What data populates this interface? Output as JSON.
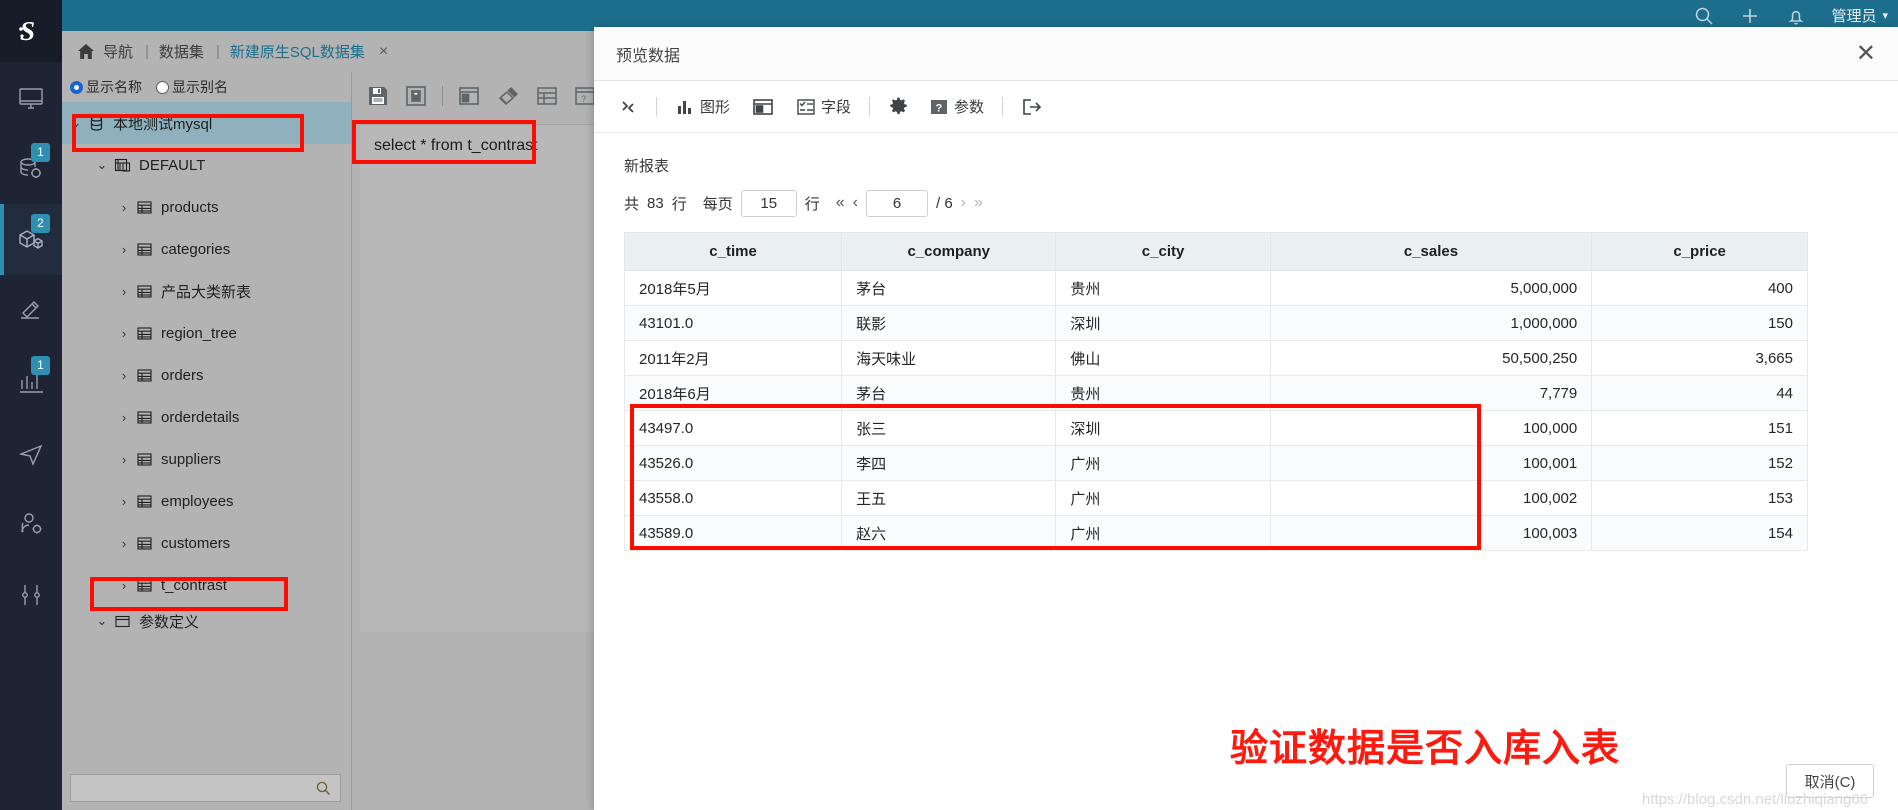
{
  "topbar": {
    "icons": [
      "search-icon",
      "plus-icon",
      "bell-icon"
    ],
    "user": "管理员",
    "brand_color": "#1d6e8c"
  },
  "tabs": {
    "home_label": "导航",
    "crumb": "数据集",
    "active_tab": "新建原生SQL数据集",
    "close": "×"
  },
  "left_panel": {
    "radio_name": "显示名称",
    "radio_alias": "显示别名",
    "tree": [
      {
        "label": "本地测试mysql",
        "depth": 0,
        "icon": "database-icon",
        "chev": "⌄",
        "selected": true
      },
      {
        "label": "DEFAULT",
        "depth": 1,
        "icon": "schema-icon",
        "chev": "⌄",
        "selected": false
      },
      {
        "label": "products",
        "depth": 2,
        "icon": "table-icon",
        "chev": "›",
        "selected": false
      },
      {
        "label": "categories",
        "depth": 2,
        "icon": "table-icon",
        "chev": "›",
        "selected": false
      },
      {
        "label": "产品大类新表",
        "depth": 2,
        "icon": "table-icon",
        "chev": "›",
        "selected": false
      },
      {
        "label": "region_tree",
        "depth": 2,
        "icon": "table-icon",
        "chev": "›",
        "selected": false
      },
      {
        "label": "orders",
        "depth": 2,
        "icon": "table-icon",
        "chev": "›",
        "selected": false
      },
      {
        "label": "orderdetails",
        "depth": 2,
        "icon": "table-icon",
        "chev": "›",
        "selected": false
      },
      {
        "label": "suppliers",
        "depth": 2,
        "icon": "table-icon",
        "chev": "›",
        "selected": false
      },
      {
        "label": "employees",
        "depth": 2,
        "icon": "table-icon",
        "chev": "›",
        "selected": false
      },
      {
        "label": "customers",
        "depth": 2,
        "icon": "table-icon",
        "chev": "›",
        "selected": false
      },
      {
        "label": "t_contrast",
        "depth": 2,
        "icon": "table-icon",
        "chev": "›",
        "selected": false
      },
      {
        "label": "参数定义",
        "depth": 1,
        "icon": "folder-icon",
        "chev": "⌄",
        "selected": false
      }
    ],
    "search_placeholder": ""
  },
  "sql_editor": {
    "toolbar_icons": [
      "save-icon",
      "save-as-icon",
      "layout-icon",
      "clean-icon",
      "grid-icon",
      "help-icon"
    ],
    "sql_text": "select * from t_contrast"
  },
  "rail": {
    "logo": "s-logo",
    "items": [
      {
        "icon": "monitor-icon",
        "badge": "",
        "active": false
      },
      {
        "icon": "database-gear-icon",
        "badge": "1",
        "active": false
      },
      {
        "icon": "cube-icon",
        "badge": "2",
        "active": true
      },
      {
        "icon": "hammer-icon",
        "badge": "",
        "active": false
      },
      {
        "icon": "bar-chart-icon",
        "badge": "1",
        "active": false
      },
      {
        "icon": "paper-plane-icon",
        "badge": "",
        "active": false
      },
      {
        "icon": "user-gear-icon",
        "badge": "",
        "active": false
      },
      {
        "icon": "tools-icon",
        "badge": "",
        "active": false
      }
    ]
  },
  "dialog": {
    "title": "预览数据",
    "close": "✕",
    "toolbar": [
      {
        "icon": "refresh-icon",
        "label": ""
      },
      {
        "icon": "chart-icon",
        "label": "图形"
      },
      {
        "icon": "layout-icon",
        "label": ""
      },
      {
        "icon": "field-icon",
        "label": "字段"
      },
      {
        "icon": "gear-icon",
        "label": ""
      },
      {
        "icon": "question-icon",
        "label": "参数"
      },
      {
        "icon": "export-icon",
        "label": ""
      }
    ],
    "report_name": "新报表",
    "pager": {
      "total_prefix": "共",
      "total": "83",
      "total_suffix": "行",
      "per_page_label": "每页",
      "per_page": "15",
      "per_page_suffix": "行",
      "first": "«",
      "prev": "‹",
      "current_page": "6",
      "page_of": "/ 6",
      "next": "›",
      "last": "»"
    },
    "table": {
      "columns": [
        "c_time",
        "c_company",
        "c_city",
        "c_sales",
        "c_price"
      ],
      "rows": [
        [
          "2018年5月",
          "茅台",
          "贵州",
          "5,000,000",
          "400"
        ],
        [
          "43101.0",
          "联影",
          "深圳",
          "1,000,000",
          "150"
        ],
        [
          "2011年2月",
          "海天味业",
          "佛山",
          "50,500,250",
          "3,665"
        ],
        [
          "2018年6月",
          "茅台",
          "贵州",
          "7,779",
          "44"
        ],
        [
          "43497.0",
          "张三",
          "深圳",
          "100,000",
          "151"
        ],
        [
          "43526.0",
          "李四",
          "广州",
          "100,001",
          "152"
        ],
        [
          "43558.0",
          "王五",
          "广州",
          "100,002",
          "153"
        ],
        [
          "43589.0",
          "赵六",
          "广州",
          "100,003",
          "154"
        ]
      ]
    },
    "annotation": "验证数据是否入库入表",
    "cancel_label": "取消(C)",
    "watermark": "https://blog.csdn.net/liuzhiqiang66",
    "annotation_color": "#ff1a10"
  }
}
